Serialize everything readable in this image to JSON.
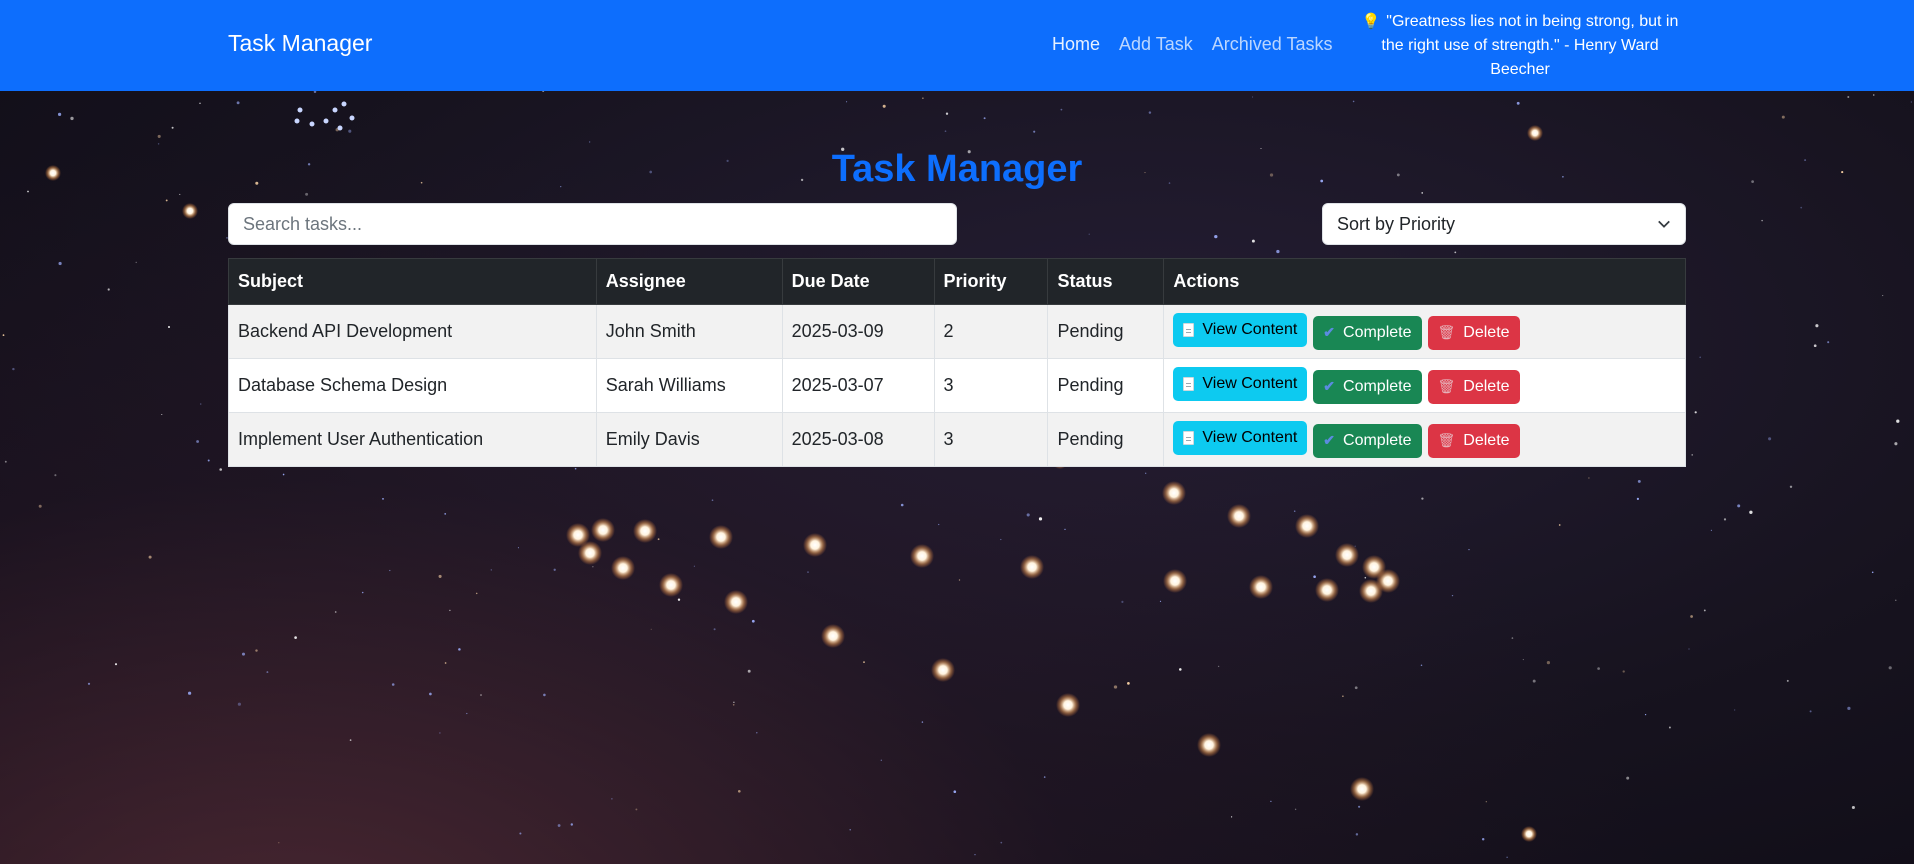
{
  "navbar": {
    "brand": "Task Manager",
    "links": [
      {
        "label": "Home"
      },
      {
        "label": "Add Task"
      },
      {
        "label": "Archived Tasks"
      }
    ],
    "quote": "\"Greatness lies not in being strong, but in the right use of strength.\" - Henry Ward Beecher",
    "quote_icon": "lightbulb-icon"
  },
  "page_title": "Task Manager",
  "search": {
    "placeholder": "Search tasks...",
    "value": ""
  },
  "sort": {
    "selected": "Sort by Priority"
  },
  "table": {
    "headers": [
      "Subject",
      "Assignee",
      "Due Date",
      "Priority",
      "Status",
      "Actions"
    ],
    "rows": [
      {
        "subject": "Backend API Development",
        "assignee": "John Smith",
        "due_date": "2025-03-09",
        "priority": "2",
        "status": "Pending"
      },
      {
        "subject": "Database Schema Design",
        "assignee": "Sarah Williams",
        "due_date": "2025-03-07",
        "priority": "3",
        "status": "Pending"
      },
      {
        "subject": "Implement User Authentication",
        "assignee": "Emily Davis",
        "due_date": "2025-03-08",
        "priority": "3",
        "status": "Pending"
      }
    ],
    "actions": {
      "view": "View Content",
      "complete": "Complete",
      "delete": "Delete"
    }
  },
  "colors": {
    "primary": "#0d6efd",
    "info": "#0dcaf0",
    "success": "#198754",
    "danger": "#dc3545",
    "table_header": "#212529"
  }
}
